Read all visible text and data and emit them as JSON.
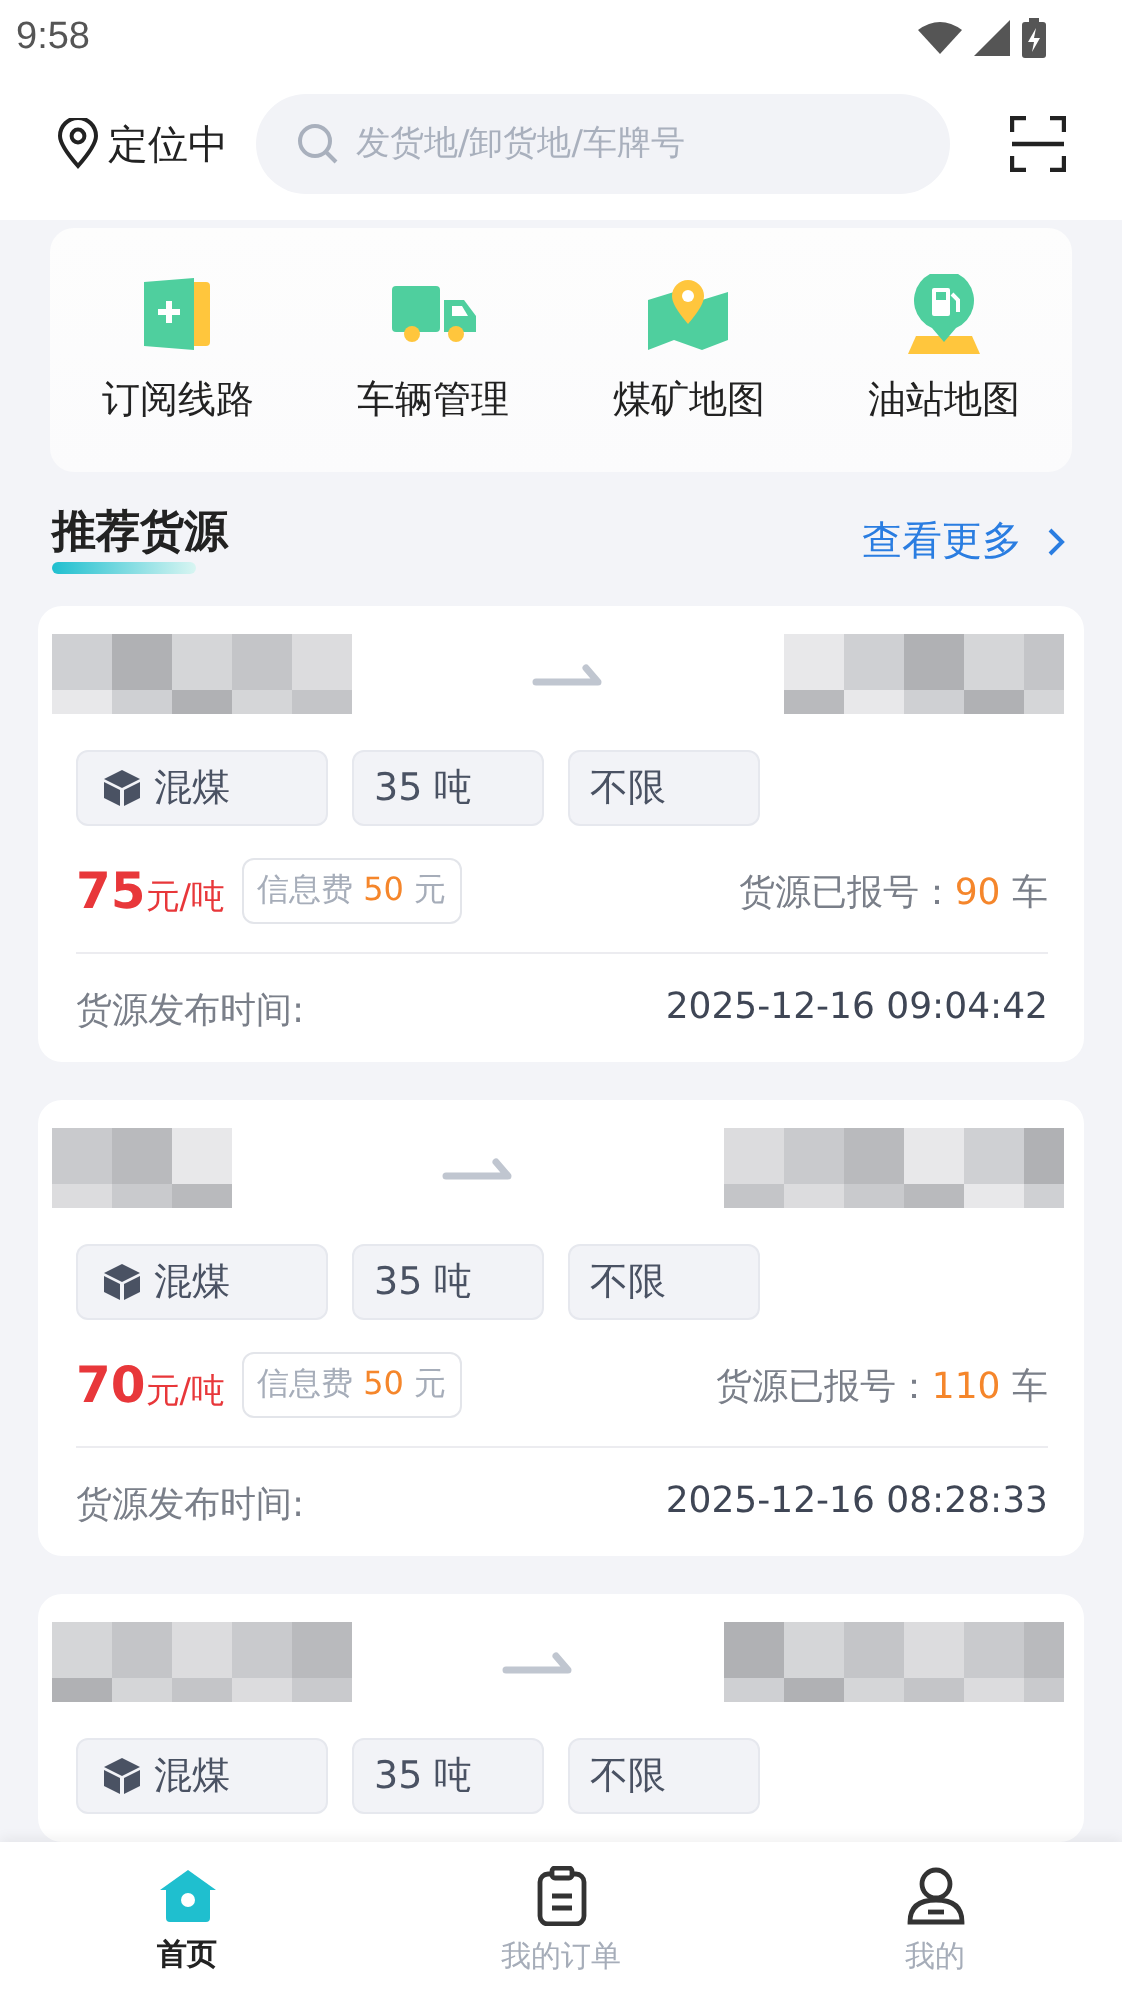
{
  "status_bar": {
    "time": "9:58"
  },
  "header": {
    "location": "定位中",
    "search": {
      "placeholder": "发货地/卸货地/车牌号"
    }
  },
  "quick_menu": [
    {
      "kind": "subscribe",
      "label": "订阅线路"
    },
    {
      "kind": "truck",
      "label": "车辆管理"
    },
    {
      "kind": "map",
      "label": "煤矿地图"
    },
    {
      "kind": "fuel",
      "label": "油站地图"
    }
  ],
  "section": {
    "title": "推荐货源",
    "more": "查看更多"
  },
  "cards": [
    {
      "tags": [
        {
          "kind": "cargo",
          "text": "混煤"
        },
        {
          "kind": "plain",
          "text": "35 吨"
        },
        {
          "kind": "plain",
          "text": "不限"
        }
      ],
      "price": "75",
      "price_unit": "元/吨",
      "fee_label": "信息费",
      "fee": "50",
      "fee_unit": "元",
      "reported_label": "货源已报号：",
      "reported": "90",
      "reported_unit": "车",
      "time_label": "货源发布时间:",
      "time": "2025-12-16 09:04:42"
    },
    {
      "tags": [
        {
          "kind": "cargo",
          "text": "混煤"
        },
        {
          "kind": "plain",
          "text": "35 吨"
        },
        {
          "kind": "plain",
          "text": "不限"
        }
      ],
      "price": "70",
      "price_unit": "元/吨",
      "fee_label": "信息费",
      "fee": "50",
      "fee_unit": "元",
      "reported_label": "货源已报号：",
      "reported": "110",
      "reported_unit": "车",
      "time_label": "货源发布时间:",
      "time": "2025-12-16 08:28:33"
    },
    {
      "tags": [
        {
          "kind": "cargo",
          "text": "混煤"
        },
        {
          "kind": "plain",
          "text": "35 吨"
        },
        {
          "kind": "plain",
          "text": "不限"
        }
      ]
    }
  ],
  "tab_bar": [
    {
      "kind": "home",
      "label": "首页",
      "selected": true
    },
    {
      "kind": "orders",
      "label": "我的订单",
      "selected": false
    },
    {
      "kind": "profile",
      "label": "我的",
      "selected": false
    }
  ]
}
